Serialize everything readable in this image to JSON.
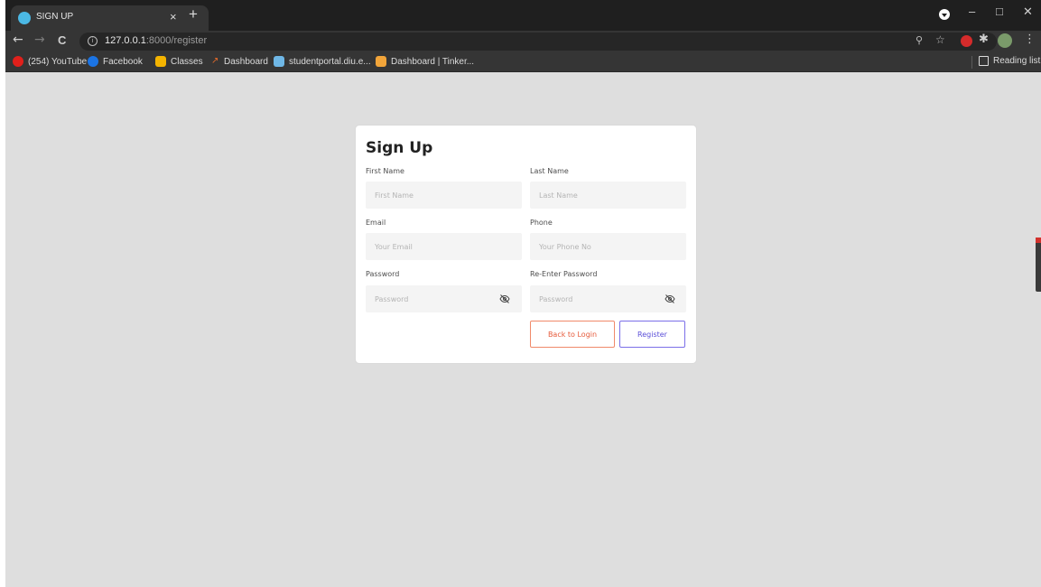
{
  "browser": {
    "tab_title": "SIGN UP",
    "tab_close": "×",
    "new_tab": "+",
    "url_host": "127.0.0.1",
    "url_rest": ":8000/register",
    "window_controls": {
      "minimize": "–",
      "maximize": "□",
      "close": "✕"
    },
    "nav": {
      "back": "←",
      "forward": "→",
      "reload": "C"
    },
    "bookmarks": [
      {
        "label": "(254) YouTube",
        "color": "#e0201b"
      },
      {
        "label": "Facebook",
        "color": "#1b74e4"
      },
      {
        "label": "Classes",
        "color": "#f4b400"
      },
      {
        "label": "Dashboard",
        "color": "#e56a2a"
      },
      {
        "label": "studentportal.diu.e...",
        "color": "#6fb7e6"
      },
      {
        "label": "Dashboard | Tinker...",
        "color": "#f2a53a"
      }
    ],
    "reading_list": "Reading list"
  },
  "form": {
    "title": "Sign Up",
    "first_name": {
      "label": "First Name",
      "placeholder": "First Name"
    },
    "last_name": {
      "label": "Last Name",
      "placeholder": "Last Name"
    },
    "email": {
      "label": "Email",
      "placeholder": "Your Email"
    },
    "phone": {
      "label": "Phone",
      "placeholder": "Your Phone No"
    },
    "password": {
      "label": "Password",
      "placeholder": "Password"
    },
    "re_password": {
      "label": "Re-Enter Password",
      "placeholder": "Password"
    },
    "back_button": "Back to Login",
    "register_button": "Register"
  },
  "colors": {
    "back_button": "#e65a3a",
    "register_button": "#5b4fd8",
    "page_bg": "#dedede"
  }
}
